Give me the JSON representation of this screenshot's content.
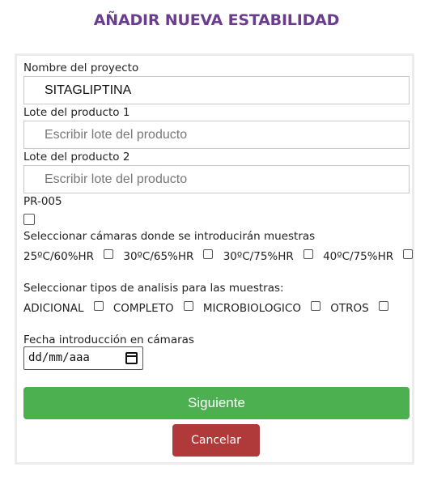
{
  "page": {
    "title": "AÑADIR NUEVA ESTABILIDAD"
  },
  "form": {
    "project": {
      "label": "Nombre del proyecto",
      "value": "SITAGLIPTINA"
    },
    "lot1": {
      "label": "Lote del producto 1",
      "placeholder": "Escribir lote del producto"
    },
    "lot2": {
      "label": "Lote del producto 2",
      "placeholder": "Escribir lote del producto"
    },
    "pr005": {
      "label": "PR-005",
      "checked": false
    },
    "chambers": {
      "label": "Seleccionar cámaras donde se introducirán muestras",
      "options": [
        "25ºC/60%HR",
        "30ºC/65%HR",
        "30ºC/75%HR",
        "40ºC/75%HR"
      ]
    },
    "analysis": {
      "label": "Seleccionar tipos de analisis para las muestras:",
      "options": [
        "ADICIONAL",
        "COMPLETO",
        "MICROBIOLOGICO",
        "OTROS"
      ]
    },
    "date": {
      "label": "Fecha introducción en cámaras",
      "placeholder": "dd/mm/aaa"
    },
    "next_label": "Siguiente",
    "cancel_label": "Cancelar"
  },
  "colors": {
    "title": "#6b3d8d",
    "next": "#4caf50",
    "cancel": "#b03a3a"
  }
}
